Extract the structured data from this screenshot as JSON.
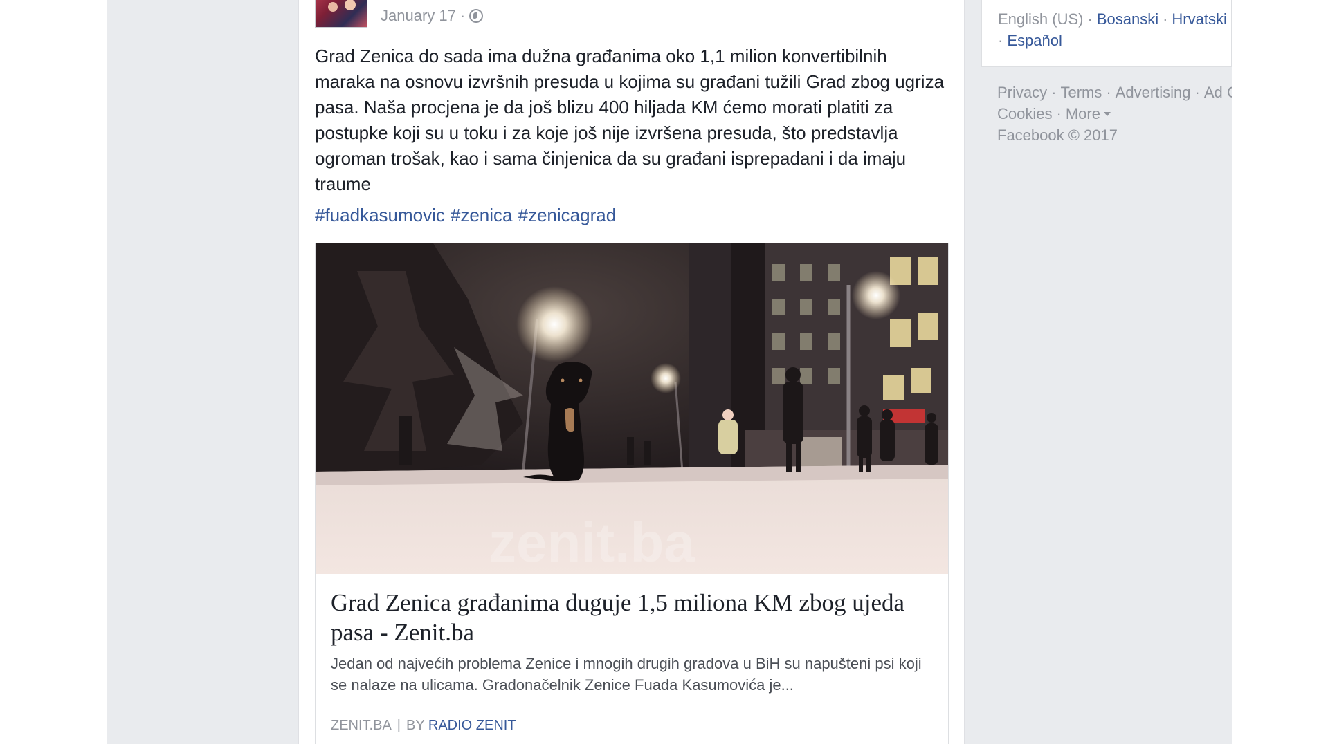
{
  "post": {
    "date": "January 17",
    "separator": "·",
    "body": "Grad Zenica do sada ima dužna građanima oko 1,1 milion konvertibilnih maraka na osnovu izvršnih presuda u kojima su građani tužili Grad zbog ugriza pasa. Naša procjena je da još blizu 400 hiljada KM ćemo morati platiti za postupke koji su u toku i za koje još nije izvršena presuda, što predstavlja ogroman trošak, kao i sama činjenica da su građani isprepadani i da imaju traume",
    "hashtags": [
      "#fuadkasumovic",
      "#zenica",
      "#zenicagrad"
    ]
  },
  "link_preview": {
    "title": "Grad Zenica građanima duguje 1,5 miliona KM zbog ujeda pasa - Zenit.ba",
    "description": "Jedan od najvećih problema Zenice i mnogih drugih gradova u BiH su napušteni psi koji se nalaze na ulicama. Gradonačelnik Zenice Fuada Kasumovića je...",
    "domain": "ZENIT.BA",
    "pipe": "|",
    "by": "BY",
    "author": "RADIO ZENIT",
    "image_watermark": "zenit.ba"
  },
  "languages": {
    "current": "English (US)",
    "others": [
      "Bosanski",
      "Hrvatski"
    ],
    "second_line": "Español"
  },
  "footer": {
    "links": [
      "Privacy",
      "Terms",
      "Advertising",
      "Ad Choices"
    ],
    "line2_links": [
      "Cookies",
      "More"
    ],
    "copyright": "Facebook © 2017"
  },
  "colors": {
    "link": "#365899",
    "muted": "#90949c",
    "text": "#1d2129",
    "background": "#e9ebee"
  }
}
